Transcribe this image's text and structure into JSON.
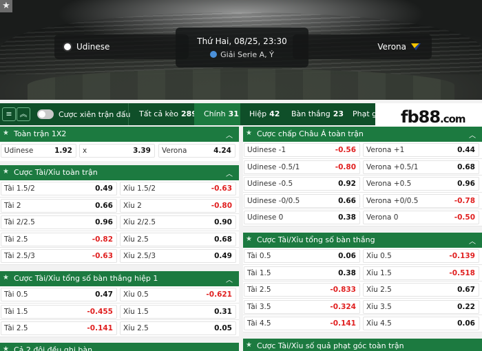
{
  "match": {
    "home_team": "Udinese",
    "away_team": "Verona",
    "datetime": "Thứ Hai, 08/25, 23:30",
    "league": "Giải Serie A, Ý"
  },
  "tabs": {
    "parlay_toggle_label": "Cược xiên trận đấu",
    "items": [
      {
        "label": "Tất cả kèo",
        "count": "289"
      },
      {
        "label": "Chính",
        "count": "31"
      },
      {
        "label": "Hiệp",
        "count": "42"
      },
      {
        "label": "Bàn thắng",
        "count": "23"
      },
      {
        "label": "Phạt góc",
        "count": ""
      }
    ]
  },
  "brand": {
    "name": "fb88",
    "domain": ".com"
  },
  "colors": {
    "header_green": "#1c7a40",
    "dark_green": "#0f4f29",
    "negative_odds": "#e02020"
  },
  "panels": {
    "full_1x2": {
      "title": "Toàn trận 1X2",
      "cells": [
        {
          "label": "Udinese",
          "odds": "1.92"
        },
        {
          "label": "x",
          "odds": "3.39"
        },
        {
          "label": "Verona",
          "odds": "4.24"
        }
      ]
    },
    "full_ou": {
      "title": "Cược Tài/Xỉu toàn trận",
      "rows": [
        [
          {
            "label": "Tài 1.5/2",
            "odds": "0.49"
          },
          {
            "label": "Xỉu 1.5/2",
            "odds": "-0.63"
          }
        ],
        [
          {
            "label": "Tài 2",
            "odds": "0.66"
          },
          {
            "label": "Xỉu 2",
            "odds": "-0.80"
          }
        ],
        [
          {
            "label": "Tài 2/2.5",
            "odds": "0.96"
          },
          {
            "label": "Xỉu 2/2.5",
            "odds": "0.90"
          }
        ],
        [
          {
            "label": "Tài 2.5",
            "odds": "-0.82"
          },
          {
            "label": "Xỉu 2.5",
            "odds": "0.68"
          }
        ],
        [
          {
            "label": "Tài 2.5/3",
            "odds": "-0.63"
          },
          {
            "label": "Xỉu 2.5/3",
            "odds": "0.49"
          }
        ]
      ]
    },
    "goals_ou_h1": {
      "title": "Cược Tài/Xỉu tổng số bàn thắng hiệp 1",
      "rows": [
        [
          {
            "label": "Tài 0.5",
            "odds": "0.47"
          },
          {
            "label": "Xỉu 0.5",
            "odds": "-0.621"
          }
        ],
        [
          {
            "label": "Tài 1.5",
            "odds": "-0.455"
          },
          {
            "label": "Xỉu 1.5",
            "odds": "0.31"
          }
        ],
        [
          {
            "label": "Tài 2.5",
            "odds": "-0.141"
          },
          {
            "label": "Xỉu 2.5",
            "odds": "0.05"
          }
        ]
      ]
    },
    "btts": {
      "title": "Cả 2 đội đều ghi bàn"
    },
    "asian_handicap": {
      "title": "Cược chấp Châu Á toàn trận",
      "rows": [
        [
          {
            "label": "Udinese -1",
            "odds": "-0.56"
          },
          {
            "label": "Verona +1",
            "odds": "0.44"
          }
        ],
        [
          {
            "label": "Udinese -0.5/1",
            "odds": "-0.80"
          },
          {
            "label": "Verona +0.5/1",
            "odds": "0.68"
          }
        ],
        [
          {
            "label": "Udinese -0.5",
            "odds": "0.92"
          },
          {
            "label": "Verona +0.5",
            "odds": "0.96"
          }
        ],
        [
          {
            "label": "Udinese -0/0.5",
            "odds": "0.66"
          },
          {
            "label": "Verona +0/0.5",
            "odds": "-0.78"
          }
        ],
        [
          {
            "label": "Udinese 0",
            "odds": "0.38"
          },
          {
            "label": "Verona 0",
            "odds": "-0.50"
          }
        ]
      ]
    },
    "goals_ou_full": {
      "title": "Cược Tài/Xỉu tổng số bàn thắng",
      "rows": [
        [
          {
            "label": "Tài 0.5",
            "odds": "0.06"
          },
          {
            "label": "Xỉu 0.5",
            "odds": "-0.139"
          }
        ],
        [
          {
            "label": "Tài 1.5",
            "odds": "0.38"
          },
          {
            "label": "Xỉu 1.5",
            "odds": "-0.518"
          }
        ],
        [
          {
            "label": "Tài 2.5",
            "odds": "-0.833"
          },
          {
            "label": "Xỉu 2.5",
            "odds": "0.67"
          }
        ],
        [
          {
            "label": "Tài 3.5",
            "odds": "-0.324"
          },
          {
            "label": "Xỉu 3.5",
            "odds": "0.22"
          }
        ],
        [
          {
            "label": "Tài 4.5",
            "odds": "-0.141"
          },
          {
            "label": "Xỉu 4.5",
            "odds": "0.06"
          }
        ]
      ]
    },
    "corners_ou": {
      "title": "Cược Tài/Xỉu số quả phạt góc toàn trận"
    }
  }
}
